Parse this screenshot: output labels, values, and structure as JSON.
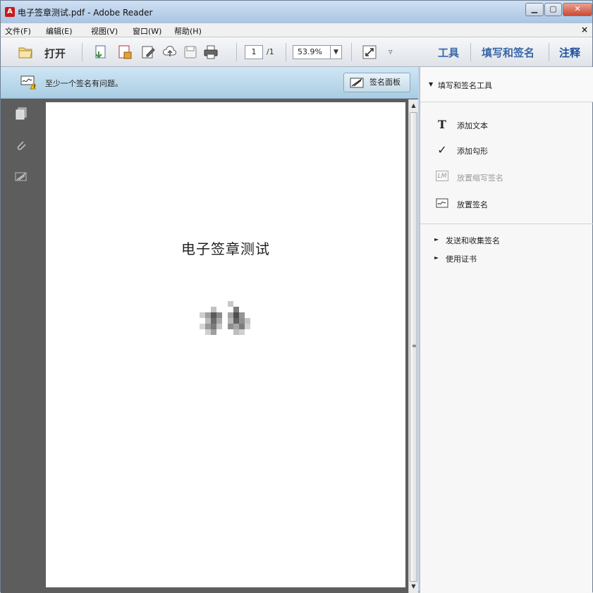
{
  "window": {
    "title": "电子签章测试.pdf - Adobe Reader",
    "app_icon": "adobe-reader-icon",
    "controls": [
      "minimize",
      "maximize",
      "close"
    ]
  },
  "menu": {
    "items": [
      "文件(F)",
      "编辑(E)",
      "视图(V)",
      "窗口(W)",
      "帮助(H)"
    ],
    "close_glyph": "×"
  },
  "toolbar": {
    "open_label": "打开",
    "page_current": "1",
    "page_total": "/1",
    "zoom": "53.9%",
    "zoom_dropdown_glyph": "▼",
    "more_glyph": "▿",
    "right_tabs": [
      "工具",
      "填写和签名",
      "注释"
    ],
    "colors": {
      "tab_text": "#3a67a8",
      "tab_active": "#1f4f99"
    }
  },
  "signature_bar": {
    "message": "至少一个签名有问题。",
    "button_label": "签名面板"
  },
  "document": {
    "title": "电子签章测试",
    "signature_image": "pixelated-handwritten-signature"
  },
  "scrollbar": {
    "up_glyph": "▲",
    "down_glyph": "▼",
    "grip_glyph": "≡"
  },
  "right_panel": {
    "header_glyph": "▼",
    "header": "填写和签名工具",
    "tools": [
      {
        "label": "添加文本",
        "icon": "text-T-icon",
        "glyph": "T",
        "enabled": true
      },
      {
        "label": "添加勾形",
        "icon": "checkmark-icon",
        "glyph": "✓",
        "enabled": true
      },
      {
        "label": "放置缩写签名",
        "icon": "initials-icon",
        "glyph": "LM",
        "enabled": false
      },
      {
        "label": "放置签名",
        "icon": "signature-icon",
        "glyph": "",
        "enabled": true
      }
    ],
    "section_glyph": "►",
    "sections": [
      "发送和收集签名",
      "使用证书"
    ]
  }
}
